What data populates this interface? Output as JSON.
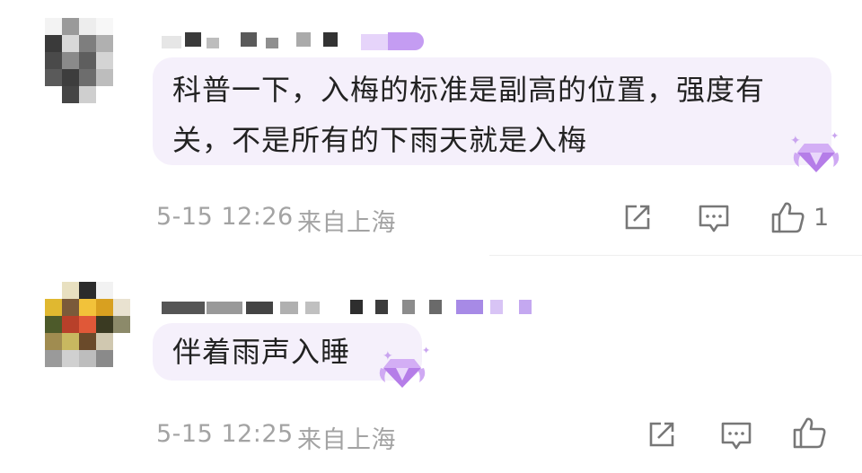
{
  "comments": [
    {
      "text": "科普一下，入梅的标准是副高的位置，强度有关，不是所有的下雨天就是入梅",
      "line1": "科普一下，入梅的标准是副高的位置，强度有",
      "line2": "关，不是所有的下雨天就是入梅",
      "timestamp": "5-15 12:26",
      "location": "来自上海",
      "like_count": "1"
    },
    {
      "text": "伴着雨声入睡",
      "line1": "伴着雨声入睡",
      "timestamp": "5-15 12:25",
      "location": "来自上海",
      "like_count": ""
    }
  ],
  "icons": {
    "share": "share-icon",
    "reply": "comment-icon",
    "like": "thumbs-up-icon",
    "badge": "gem-badge-icon"
  },
  "colors": {
    "bubble": "#f5f0fb",
    "meta_text": "#a3a3a3",
    "icon": "#777777",
    "badge": "#b57de8"
  }
}
